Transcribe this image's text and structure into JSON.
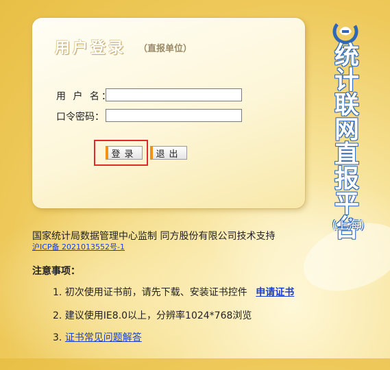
{
  "login_panel": {
    "title": "用户登录",
    "subtitle": "（直报单位）",
    "username_label": "用 户 名：",
    "password_label": "口令密码：",
    "username_value": "",
    "password_value": "",
    "login_button": "登录",
    "exit_button": "退出"
  },
  "brand": {
    "title": "统计联网直报平台",
    "region": "(上海)"
  },
  "footer": {
    "support_text": "国家统计局数据管理中心监制  同方股份有限公司技术支持",
    "icp": "沪ICP备 2021013552号-1"
  },
  "notice": {
    "title": "注意事项：",
    "item1_text": "1. 初次使用证书前，请先下载、安装证书控件",
    "item1_link": "申请证书",
    "item2_text": "2. 建议使用IE8.0以上，分辨率1024*768浏览",
    "item3_prefix": "3. ",
    "item3_link": "证书常见问题解答"
  },
  "colors": {
    "accent_orange": "#f29214",
    "highlight_red": "#e02a2a",
    "link_blue": "#1a3fd0",
    "brand_blue": "#2f67b8"
  }
}
